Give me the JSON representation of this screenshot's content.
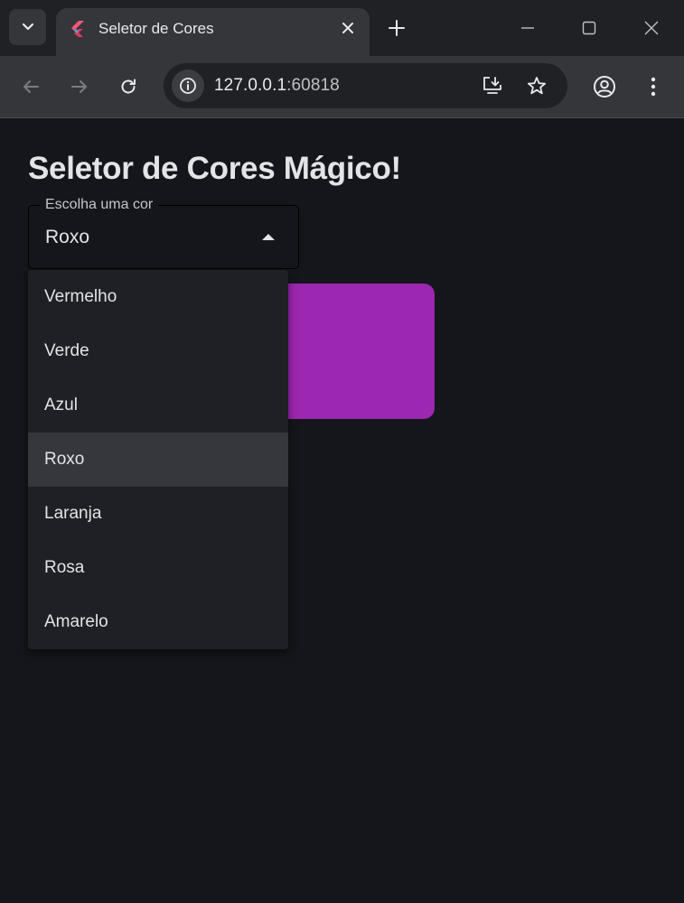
{
  "browser": {
    "tab_title": "Seletor de Cores",
    "url_host": "127.0.0.1",
    "url_port": ":60818"
  },
  "page": {
    "title": "Seletor de Cores Mágico!",
    "select_label": "Escolha uma cor",
    "selected_value": "Roxo",
    "preview_color": "#9c27b0",
    "options": [
      {
        "label": "Vermelho",
        "selected": false
      },
      {
        "label": "Verde",
        "selected": false
      },
      {
        "label": "Azul",
        "selected": false
      },
      {
        "label": "Roxo",
        "selected": true
      },
      {
        "label": "Laranja",
        "selected": false
      },
      {
        "label": "Rosa",
        "selected": false
      },
      {
        "label": "Amarelo",
        "selected": false
      }
    ]
  },
  "icons": {
    "tab_search": "chevron-down-icon",
    "favicon": "flutter-icon",
    "close": "close-icon",
    "new_tab": "plus-icon",
    "minimize": "minimize-icon",
    "maximize": "maximize-icon",
    "window_close": "close-icon",
    "back": "arrow-left-icon",
    "forward": "arrow-right-icon",
    "reload": "reload-icon",
    "site_info": "info-icon",
    "install": "install-app-icon",
    "bookmark": "star-icon",
    "profile": "account-icon",
    "menu": "more-vert-icon",
    "dropdown_caret": "caret-up-icon"
  }
}
